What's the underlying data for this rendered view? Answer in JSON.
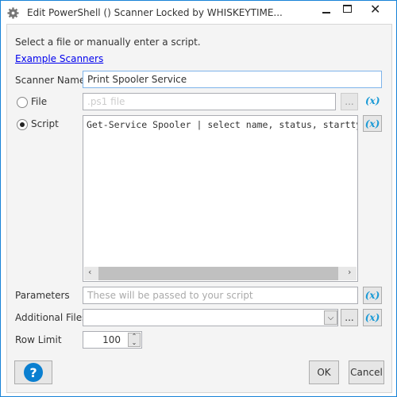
{
  "window": {
    "title": "Edit PowerShell () Scanner Locked by WHISKEYTIME...",
    "icon": "gear-icon",
    "accent": "#1883d7"
  },
  "intro": "Select a file or manually enter a script.",
  "link": "Example Scanners",
  "scanner_name": {
    "label": "Scanner Name",
    "value": "Print Spooler Service"
  },
  "file": {
    "label": "File",
    "placeholder": ".ps1 file",
    "browse": "...",
    "selected": false
  },
  "script": {
    "label": "Script",
    "value": "Get-Service Spooler | select name, status, starttype",
    "selected": true
  },
  "variable_label": "(x)",
  "parameters": {
    "label": "Parameters",
    "placeholder": "These will be passed to your script"
  },
  "additional_files": {
    "label": "Additional Files",
    "value": "",
    "browse": "..."
  },
  "row_limit": {
    "label": "Row Limit",
    "value": "100"
  },
  "buttons": {
    "ok": "OK",
    "cancel": "Cancel",
    "help": "?"
  }
}
